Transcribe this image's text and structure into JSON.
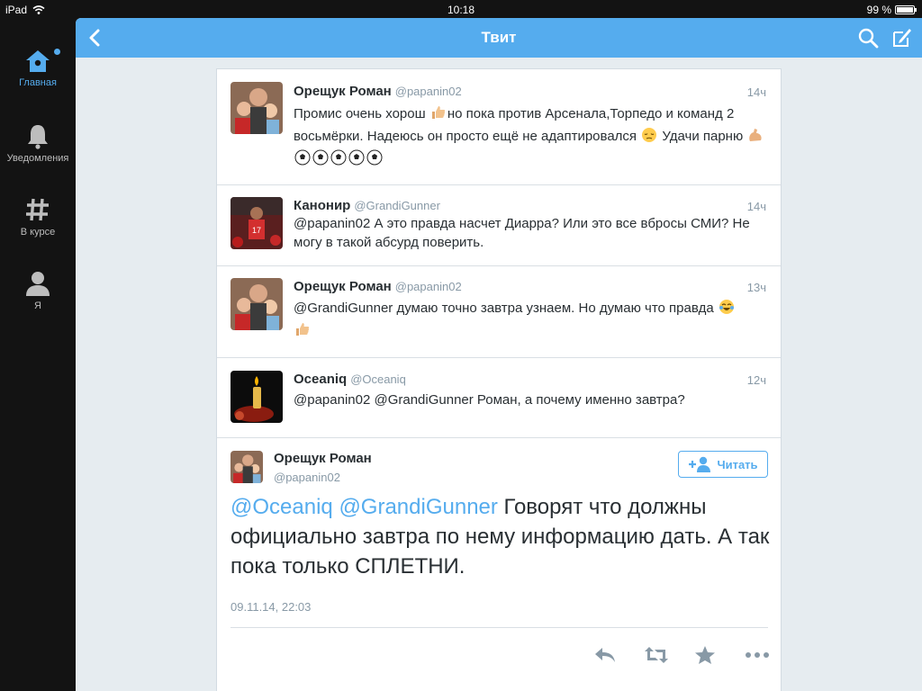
{
  "status_bar": {
    "device": "iPad",
    "time": "10:18",
    "battery": "99 %",
    "battery_level": 0.99
  },
  "sidebar": {
    "items": [
      {
        "label": "Главная",
        "icon": "home-icon",
        "active": true
      },
      {
        "label": "Уведомления",
        "icon": "bell-icon",
        "active": false
      },
      {
        "label": "В курсе",
        "icon": "hashtag-icon",
        "active": false
      },
      {
        "label": "Я",
        "icon": "person-icon",
        "active": false
      }
    ]
  },
  "header": {
    "title": "Твит",
    "icons": [
      "back-icon",
      "search-icon",
      "compose-icon"
    ]
  },
  "tweets": [
    {
      "name": "Орещук Роман",
      "handle": "@papanin02",
      "time": "14ч",
      "text_parts": [
        "Промис очень хорош ",
        "но пока против Арсенала,Торпедо и команд 2 восьмёрки. Надеюсь он просто ещё не адаптировался ",
        " Удачи парню "
      ]
    },
    {
      "name": "Канонир",
      "handle": "@GrandiGunner",
      "time": "14ч",
      "text": "@papanin02 А это правда насчет Диарра? Или это все вбросы СМИ? Не могу в такой абсурд поверить."
    },
    {
      "name": "Орещук Роман",
      "handle": "@papanin02",
      "time": "13ч",
      "text": "@GrandiGunner думаю точно завтра узнаем. Но думаю что правда "
    },
    {
      "name": "Oceaniq",
      "handle": "@Oceaniq",
      "time": "12ч",
      "text": "@papanin02 @GrandiGunner Роман, а почему именно завтра?"
    }
  ],
  "main_tweet": {
    "name": "Орещук Роман",
    "handle": "@papanin02",
    "follow_label": "Читать",
    "mention1": "@Oceaniq",
    "mention2": "@GrandiGunner",
    "text": " Говорят что должны официально завтра по нему информацию дать. А так пока только СПЛЕТНИ.",
    "timestamp": "09.11.14, 22:03",
    "actions": [
      "reply-icon",
      "retweet-icon",
      "favorite-icon",
      "more-icon"
    ]
  },
  "colors": {
    "accent": "#55acee",
    "sidebar_bg": "#131313",
    "panel_bg": "#e6ecf0"
  }
}
